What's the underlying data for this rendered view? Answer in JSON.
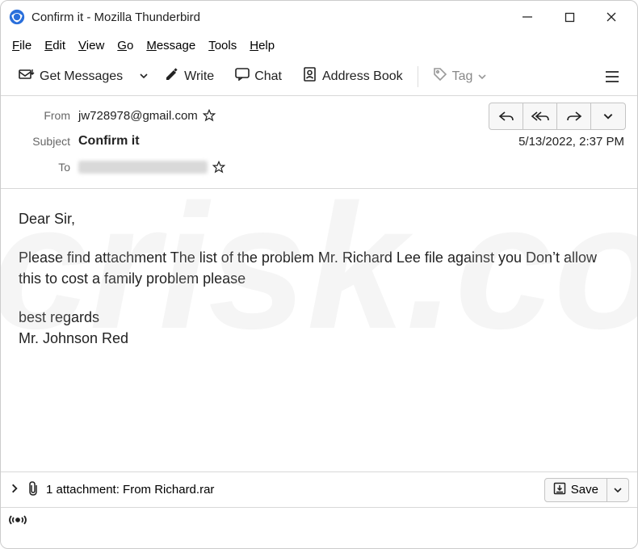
{
  "window": {
    "title": "Confirm it - Mozilla Thunderbird"
  },
  "menu": {
    "file": "File",
    "edit": "Edit",
    "view": "View",
    "go": "Go",
    "message": "Message",
    "tools": "Tools",
    "help": "Help"
  },
  "toolbar": {
    "get_messages": "Get Messages",
    "write": "Write",
    "chat": "Chat",
    "address_book": "Address Book",
    "tag": "Tag"
  },
  "headers": {
    "from_label": "From",
    "from_value": "jw728978@gmail.com",
    "subject_label": "Subject",
    "subject_value": "Confirm it",
    "to_label": "To",
    "date": "5/13/2022, 2:37 PM"
  },
  "body": {
    "greeting": "Dear Sir,",
    "para1": "Please find attachment The list of the problem Mr. Richard Lee file against you  Don’t allow this to cost a family problem please",
    "signoff": "best regards",
    "signature": "Mr. Johnson Red"
  },
  "attachment": {
    "summary": "1 attachment: From Richard.rar",
    "save": "Save"
  },
  "watermark": "pcrisk.com"
}
